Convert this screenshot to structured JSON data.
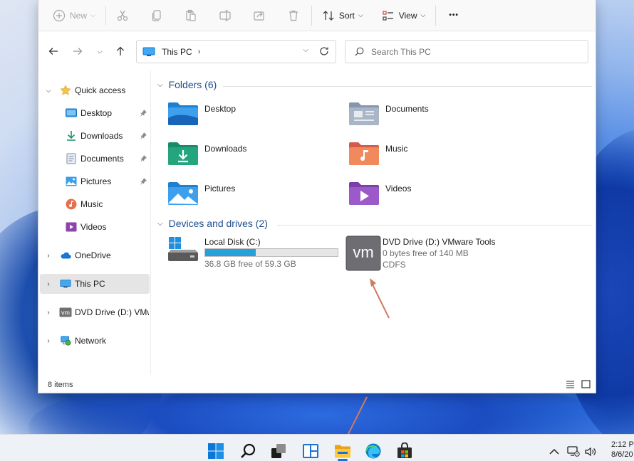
{
  "toolbar": {
    "new_label": "New",
    "sort_label": "Sort",
    "view_label": "View",
    "more_label": "•••"
  },
  "address": {
    "location": "This PC",
    "search_placeholder": "Search This PC"
  },
  "sidebar": {
    "items": [
      {
        "label": "Quick access",
        "icon": "star-icon"
      },
      {
        "label": "Desktop",
        "icon": "desktop-folder-icon",
        "pinned": true
      },
      {
        "label": "Downloads",
        "icon": "download-icon",
        "pinned": true
      },
      {
        "label": "Documents",
        "icon": "documents-icon",
        "pinned": true
      },
      {
        "label": "Pictures",
        "icon": "pictures-icon",
        "pinned": true
      },
      {
        "label": "Music",
        "icon": "music-icon"
      },
      {
        "label": "Videos",
        "icon": "videos-icon"
      },
      {
        "label": "OneDrive",
        "icon": "cloud-icon"
      },
      {
        "label": "This PC",
        "icon": "pc-icon",
        "selected": true
      },
      {
        "label": "DVD Drive (D:) VMware Tools",
        "icon": "vm-icon"
      },
      {
        "label": "Network",
        "icon": "network-icon"
      }
    ]
  },
  "content": {
    "folders_header": "Folders (6)",
    "folders": [
      {
        "label": "Desktop",
        "icon": "desktop-folder-icon"
      },
      {
        "label": "Documents",
        "icon": "documents-folder-icon"
      },
      {
        "label": "Downloads",
        "icon": "downloads-folder-icon"
      },
      {
        "label": "Music",
        "icon": "music-folder-icon"
      },
      {
        "label": "Pictures",
        "icon": "pictures-folder-icon"
      },
      {
        "label": "Videos",
        "icon": "videos-folder-icon"
      }
    ],
    "drives_header": "Devices and drives (2)",
    "drives": [
      {
        "label": "Local Disk (C:)",
        "free_text": "36.8 GB free of 59.3 GB",
        "used_fraction": 0.38,
        "icon": "hard-disk-icon"
      },
      {
        "label": "DVD Drive (D:) VMware Tools",
        "free_text": "0 bytes free of 140 MB",
        "fs": "CDFS",
        "icon": "vm-icon",
        "icon_text": "vm"
      }
    ]
  },
  "status": {
    "item_count": "8 items"
  },
  "taskbar": {
    "time": "2:12 P",
    "date": "8/6/20"
  },
  "colors": {
    "accent": "#1e4e8c",
    "disk_fill": "#26a0da",
    "arrow": "#d17a5f"
  }
}
